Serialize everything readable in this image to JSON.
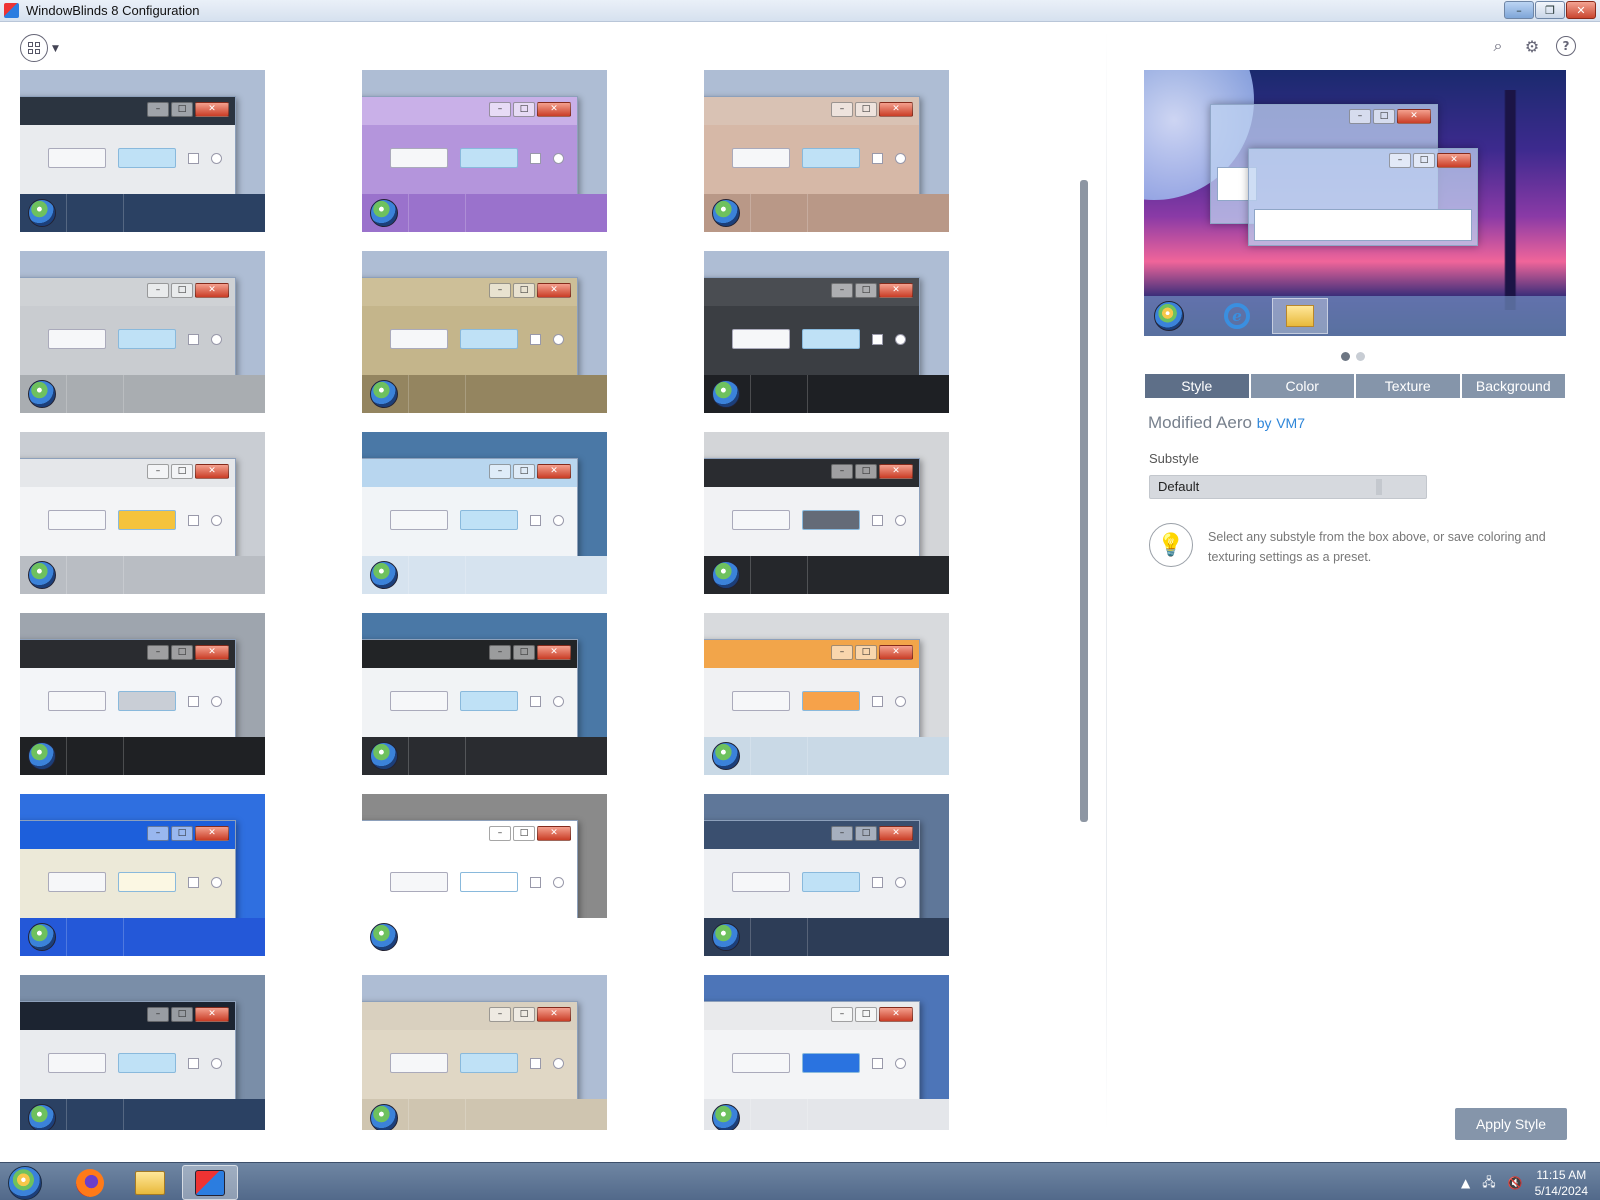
{
  "window": {
    "title": "WindowBlinds 8 Configuration",
    "buttons": {
      "minimize": "–",
      "restore": "❐",
      "close": "✕"
    }
  },
  "toolbar": {
    "view_caret": "▼",
    "search_icon": "⌕",
    "settings_icon": "⚙",
    "help_icon": "?"
  },
  "skins": [
    {
      "title_color": "#2b3440",
      "client": "#e9ebee",
      "task": "#2b4163",
      "bg": "#aebdd4",
      "accent": "#bfe1f6"
    },
    {
      "title_color": "#c9b0e8",
      "client": "#b495dc",
      "task": "#9a72cc",
      "bg": "#aebdd4",
      "accent": "#bfe1f6"
    },
    {
      "title_color": "#d9c2b4",
      "client": "#d6b8a7",
      "task": "#b99887",
      "bg": "#aebdd4",
      "accent": "#bfe1f6"
    },
    {
      "title_color": "#cfd2d5",
      "client": "#c9ccd0",
      "task": "#a9adb1",
      "bg": "#aebdd4",
      "accent": "#bfe1f6"
    },
    {
      "title_color": "#cdbf98",
      "client": "#c4b58b",
      "task": "#948560",
      "bg": "#aebdd4",
      "accent": "#bfe1f6"
    },
    {
      "title_color": "#4a4d52",
      "client": "#3b3e43",
      "task": "#1e2024",
      "bg": "#aebdd4",
      "accent": "#bfe1f6"
    },
    {
      "title_color": "#e5e7ea",
      "client": "#f3f4f6",
      "task": "#b9bdc3",
      "bg": "#c9cdd3",
      "accent": "#f4c33c"
    },
    {
      "title_color": "#b8d6ef",
      "client": "#f1f4f7",
      "task": "#d6e3ef",
      "bg": "#4a78a6",
      "accent": "#bfe1f6"
    },
    {
      "title_color": "#2a2c30",
      "client": "#f1f2f4",
      "task": "#25272b",
      "bg": "#d3d5d8",
      "accent": "#646b77"
    },
    {
      "title_color": "#2a2c30",
      "client": "#f3f5f8",
      "task": "#1f2124",
      "bg": "#9ea5ae",
      "accent": "#c9ced6"
    },
    {
      "title_color": "#222426",
      "client": "#f1f3f5",
      "task": "#2a2c30",
      "bg": "#4a78a6",
      "accent": "#bfe1f6"
    },
    {
      "title_color": "#f2a54a",
      "client": "#f0f1f3",
      "task": "#c9d9e6",
      "bg": "#d8dadd",
      "accent": "#f6a24a"
    },
    {
      "title_color": "#1d5fdb",
      "client": "#ece9d8",
      "task": "#2458d8",
      "bg": "#2f6fe0",
      "accent": "#fbf7e3"
    },
    {
      "title_color": "#ffffff",
      "client": "#ffffff",
      "task": "#ffffff",
      "bg": "#8a8a8a",
      "accent": "#ffffff"
    },
    {
      "title_color": "#3a4f6f",
      "client": "#eef0f3",
      "task": "#2d3d57",
      "bg": "#5f7799",
      "accent": "#bfe1f6"
    },
    {
      "title_color": "#1c2431",
      "client": "#e9ebee",
      "task": "#2b4163",
      "bg": "#7a8ea8",
      "accent": "#bfe1f6"
    },
    {
      "title_color": "#d9d0bf",
      "client": "#e0d7c5",
      "task": "#cfc5b0",
      "bg": "#aebdd4",
      "accent": "#bfe1f6"
    },
    {
      "title_color": "#e9eaec",
      "client": "#f3f4f6",
      "task": "#e4e6ea",
      "bg": "#4d75b8",
      "accent": "#2a73e0"
    }
  ],
  "preview": {
    "pager": {
      "dots": 2,
      "active": 0
    }
  },
  "tabs": [
    {
      "label": "Style",
      "active": true
    },
    {
      "label": "Color",
      "active": false
    },
    {
      "label": "Texture",
      "active": false
    },
    {
      "label": "Background",
      "active": false
    }
  ],
  "details": {
    "style_name": "Modified Aero",
    "author_prefix": "by",
    "author": "VM7",
    "substyle_label": "Substyle",
    "substyle_value": "Default",
    "hint": "Select any substyle from the box above, or save coloring and texturing settings as a preset."
  },
  "apply_button": "Apply Style",
  "taskbar": {
    "apps": [
      "Firefox",
      "File Explorer",
      "WindowBlinds"
    ],
    "tray": {
      "chevron": "▲",
      "time": "11:15 AM",
      "date": "5/14/2024"
    }
  }
}
